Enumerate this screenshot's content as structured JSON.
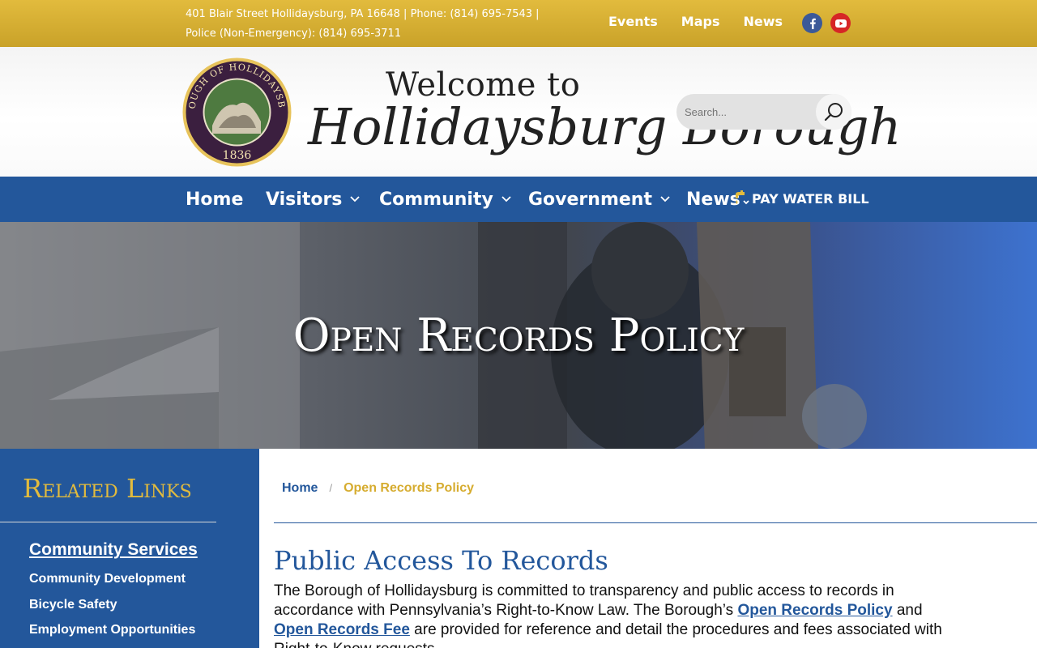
{
  "topbar": {
    "address_line1": "401 Blair Street Hollidaysburg, PA 16648 | Phone: (814) 695-7543 |",
    "address_line2": "Police (Non-Emergency): (814) 695-3711",
    "links": [
      "Events",
      "Maps",
      "News"
    ],
    "social": [
      {
        "name": "facebook-icon",
        "glyph": "f",
        "color": "#3b5998"
      },
      {
        "name": "youtube-icon",
        "glyph": "▶",
        "color": "#d62626"
      }
    ]
  },
  "header": {
    "seal_text_top": "BOROUGH OF HOLLIDAYSBURG",
    "seal_year": "1836",
    "welcome": "Welcome to",
    "script_title": "Hollidaysburg Borough",
    "search_placeholder": "Search..."
  },
  "nav": {
    "items": [
      {
        "label": "Home",
        "has_dropdown": false
      },
      {
        "label": "Visitors",
        "has_dropdown": true
      },
      {
        "label": "Community",
        "has_dropdown": true
      },
      {
        "label": "Government",
        "has_dropdown": true
      },
      {
        "label": "News",
        "has_dropdown": true
      }
    ],
    "pay_bill": "PAY WATER BILL"
  },
  "hero": {
    "title": "Open Records Policy"
  },
  "sidebar": {
    "heading": "Related Links",
    "section_title": "Community Services",
    "links": [
      "Community Development",
      "Bicycle Safety",
      "Employment Opportunities"
    ]
  },
  "breadcrumb": {
    "home": "Home",
    "separator": "/",
    "current": "Open Records Policy"
  },
  "main": {
    "heading": "Public Access To Records",
    "para_part1": "The Borough of Hollidaysburg is committed to transparency and public access to records in accordance with Pennsylvania’s Right-to-Know Law. The Borough’s ",
    "link1": "Open Records Policy",
    "para_part2": " and ",
    "link2": "Open Records Fee",
    "para_part3": " are provided for reference and detail the procedures and fees associated with Right-to-Know requests."
  },
  "colors": {
    "gold": "#d6ac2f",
    "brand_blue": "#23579b"
  }
}
